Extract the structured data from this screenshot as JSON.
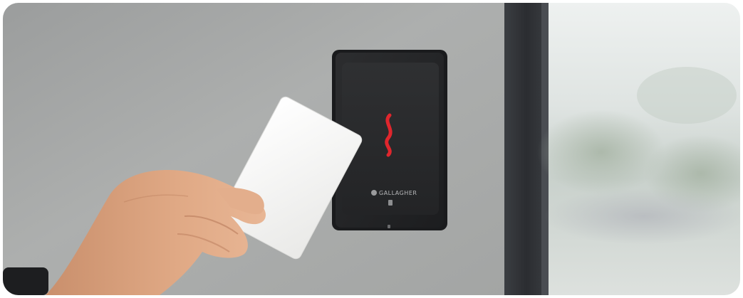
{
  "photo": {
    "reader_brand": "GALLAGHER",
    "reader_led_color": "#e0262d",
    "card_color": "#f7f7f5",
    "wall_color": "#a7a9a8",
    "door_frame_color": "#2f3236"
  }
}
